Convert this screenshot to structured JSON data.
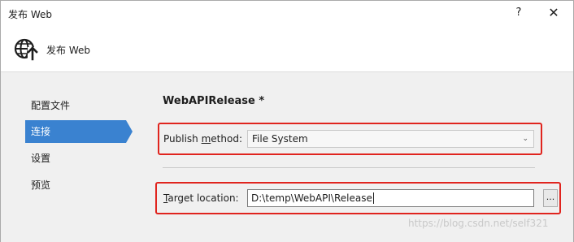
{
  "window": {
    "title": "发布 Web",
    "help_label": "?",
    "close_label": "✕"
  },
  "header": {
    "icon": "globe-publish-icon",
    "title": "发布 Web"
  },
  "nav": {
    "items": [
      {
        "label": "配置文件",
        "active": false
      },
      {
        "label": "连接",
        "active": true
      },
      {
        "label": "设置",
        "active": false
      },
      {
        "label": "预览",
        "active": false
      }
    ]
  },
  "main": {
    "profile_title": "WebAPIRelease *",
    "publish_method": {
      "label_prefix": "Publish ",
      "label_mnemonic": "m",
      "label_suffix": "ethod:",
      "value": "File System"
    },
    "target_location": {
      "label_mnemonic": "T",
      "label_suffix": "arget location:",
      "value": "D:\\temp\\WebAPI\\Release",
      "browse_label": "..."
    }
  },
  "watermark": "https://blog.csdn.net/self321",
  "colors": {
    "accent": "#3a82d0",
    "highlight_box": "#e0241e"
  }
}
